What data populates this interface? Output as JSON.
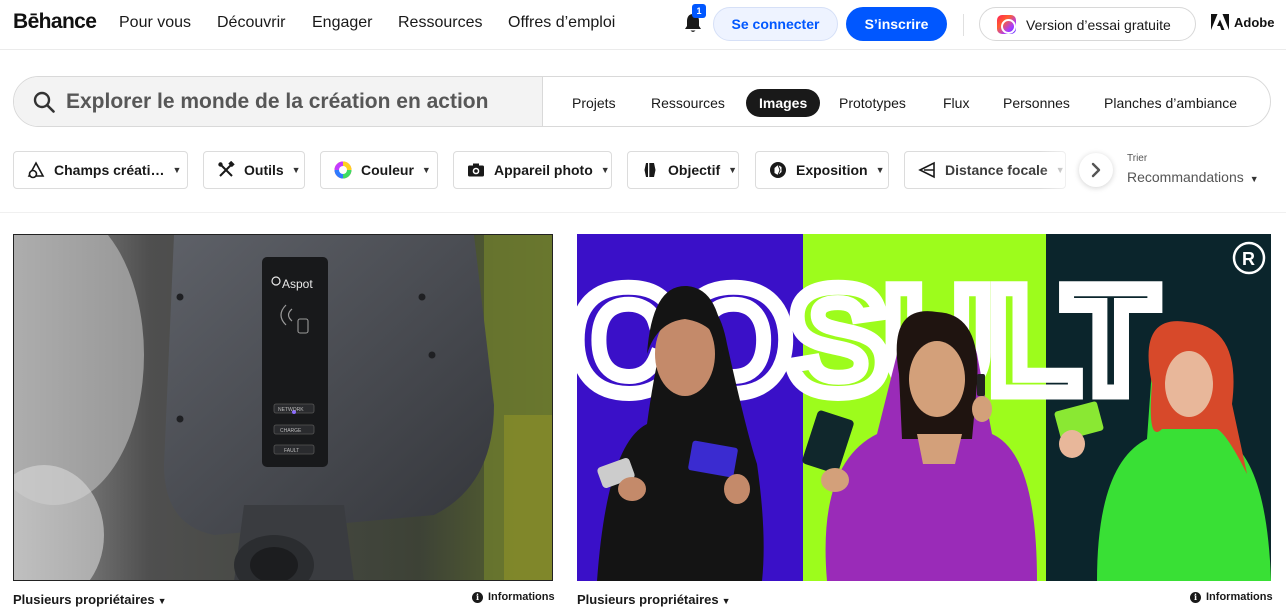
{
  "brand": {
    "logo": "Bēhance"
  },
  "nav": {
    "links": [
      "Pour vous",
      "Découvrir",
      "Engager",
      "Ressources",
      "Offres d’emploi"
    ],
    "notification_count": "1",
    "login_label": "Se connecter",
    "signup_label": "S’inscrire",
    "trial_label": "Version d’essai gratuite",
    "adobe_label": "Adobe"
  },
  "search": {
    "placeholder": "Explorer le monde de la création en action",
    "tabs": [
      {
        "label": "Projets",
        "active": false
      },
      {
        "label": "Ressources",
        "active": false
      },
      {
        "label": "Images",
        "active": true
      },
      {
        "label": "Prototypes",
        "active": false
      },
      {
        "label": "Flux",
        "active": false
      },
      {
        "label": "Personnes",
        "active": false
      },
      {
        "label": "Planches d’ambiance",
        "active": false
      }
    ]
  },
  "filters": [
    {
      "label": "Champs créati…",
      "icon": "creative-fields-icon"
    },
    {
      "label": "Outils",
      "icon": "tools-icon"
    },
    {
      "label": "Couleur",
      "icon": "color-wheel-icon"
    },
    {
      "label": "Appareil photo",
      "icon": "camera-icon"
    },
    {
      "label": "Objectif",
      "icon": "lens-icon"
    },
    {
      "label": "Exposition",
      "icon": "aperture-icon"
    },
    {
      "label": "Distance focale",
      "icon": "focal-length-icon"
    }
  ],
  "sort": {
    "label": "Trier",
    "value": "Recommandations"
  },
  "cards": [
    {
      "owner": "Plusieurs propriétaires",
      "info_label": "Informations",
      "image": {
        "device_brand": "Aspot",
        "indicators": [
          "NETWORK",
          "CHARGE",
          "FAULT"
        ]
      }
    },
    {
      "owner": "Plusieurs propriétaires",
      "info_label": "Informations",
      "image": {
        "wordmark": "COSULT",
        "panel_colors": [
          "#3a10c8",
          "#9dfc1c",
          "#0b252c"
        ]
      }
    }
  ],
  "colors": {
    "accent": "#0057ff",
    "text": "#191919"
  }
}
